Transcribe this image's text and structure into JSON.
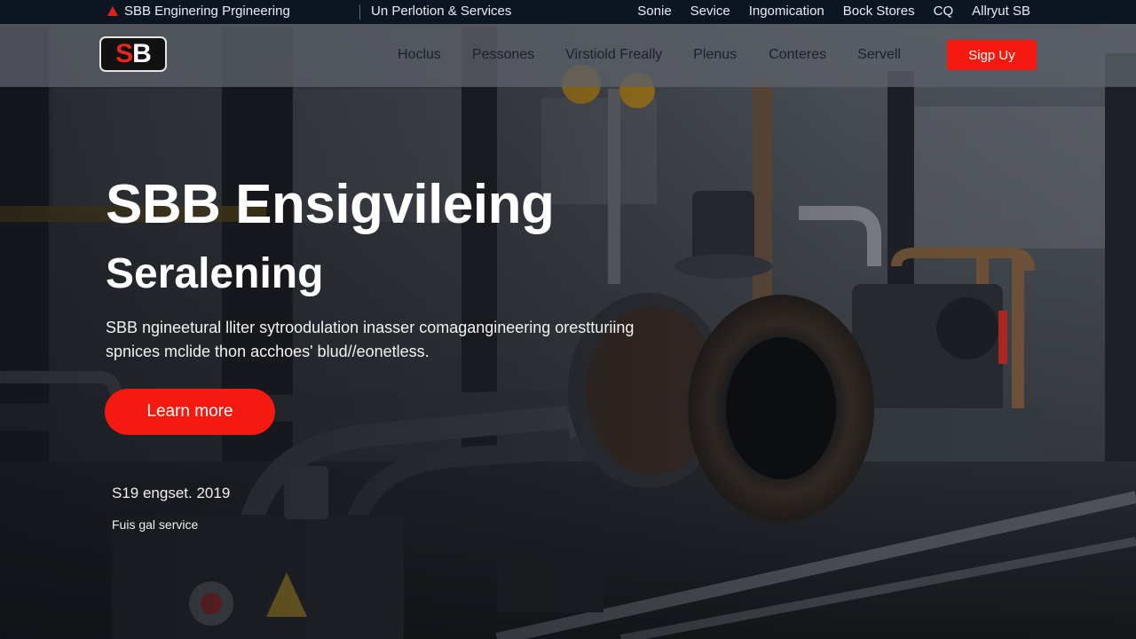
{
  "topbar": {
    "brand": "SBB Enginering Prgineering",
    "tagline": "Un Perlotion & Services",
    "links": [
      "Sonie",
      "Sevice",
      "Ingomication",
      "Bock Stores",
      "CQ",
      "Allryut SB"
    ]
  },
  "logo": {
    "letters_red": "S",
    "letters_white": "B"
  },
  "nav": {
    "links": [
      "Hoclus",
      "Pessones",
      "Virstiold Freally",
      "Plenus",
      "Conteres",
      "Servell"
    ],
    "signup_label": "Sigp Uy"
  },
  "hero": {
    "title": "SBB Ensigvileing",
    "subtitle": "Seralening",
    "description": "SBB ngineetural lliter sytroodulation inasser comagangineering orestturiing spnices mclide thon acchoes' blud//eonetless.",
    "cta_label": "Learn more",
    "established": "S19 engset. 2019",
    "service_note": "Fuis gal service"
  },
  "colors": {
    "accent": "#f5190f",
    "topbar_bg": "#0d1522",
    "navbar_bg": "#5c6068"
  },
  "icons": {
    "brand_icon": "warning-triangle-icon"
  }
}
